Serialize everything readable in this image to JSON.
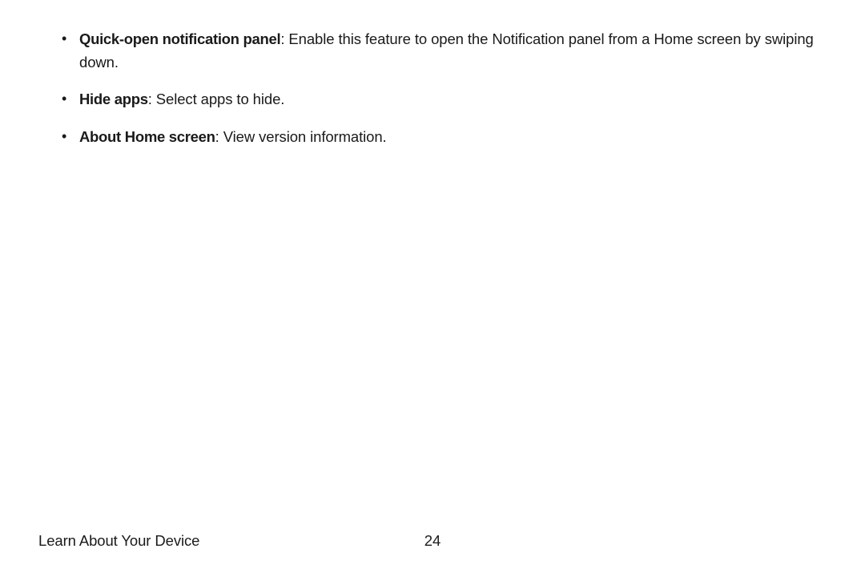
{
  "bullets": [
    {
      "term": "Quick-open notification panel",
      "desc": ": Enable this feature to open the Notification panel from a Home screen by swiping down."
    },
    {
      "term": "Hide apps",
      "desc": ": Select apps to hide."
    },
    {
      "term": "About Home screen",
      "desc": ": View version information."
    }
  ],
  "footer": {
    "title": "Learn About Your Device",
    "page": "24"
  }
}
